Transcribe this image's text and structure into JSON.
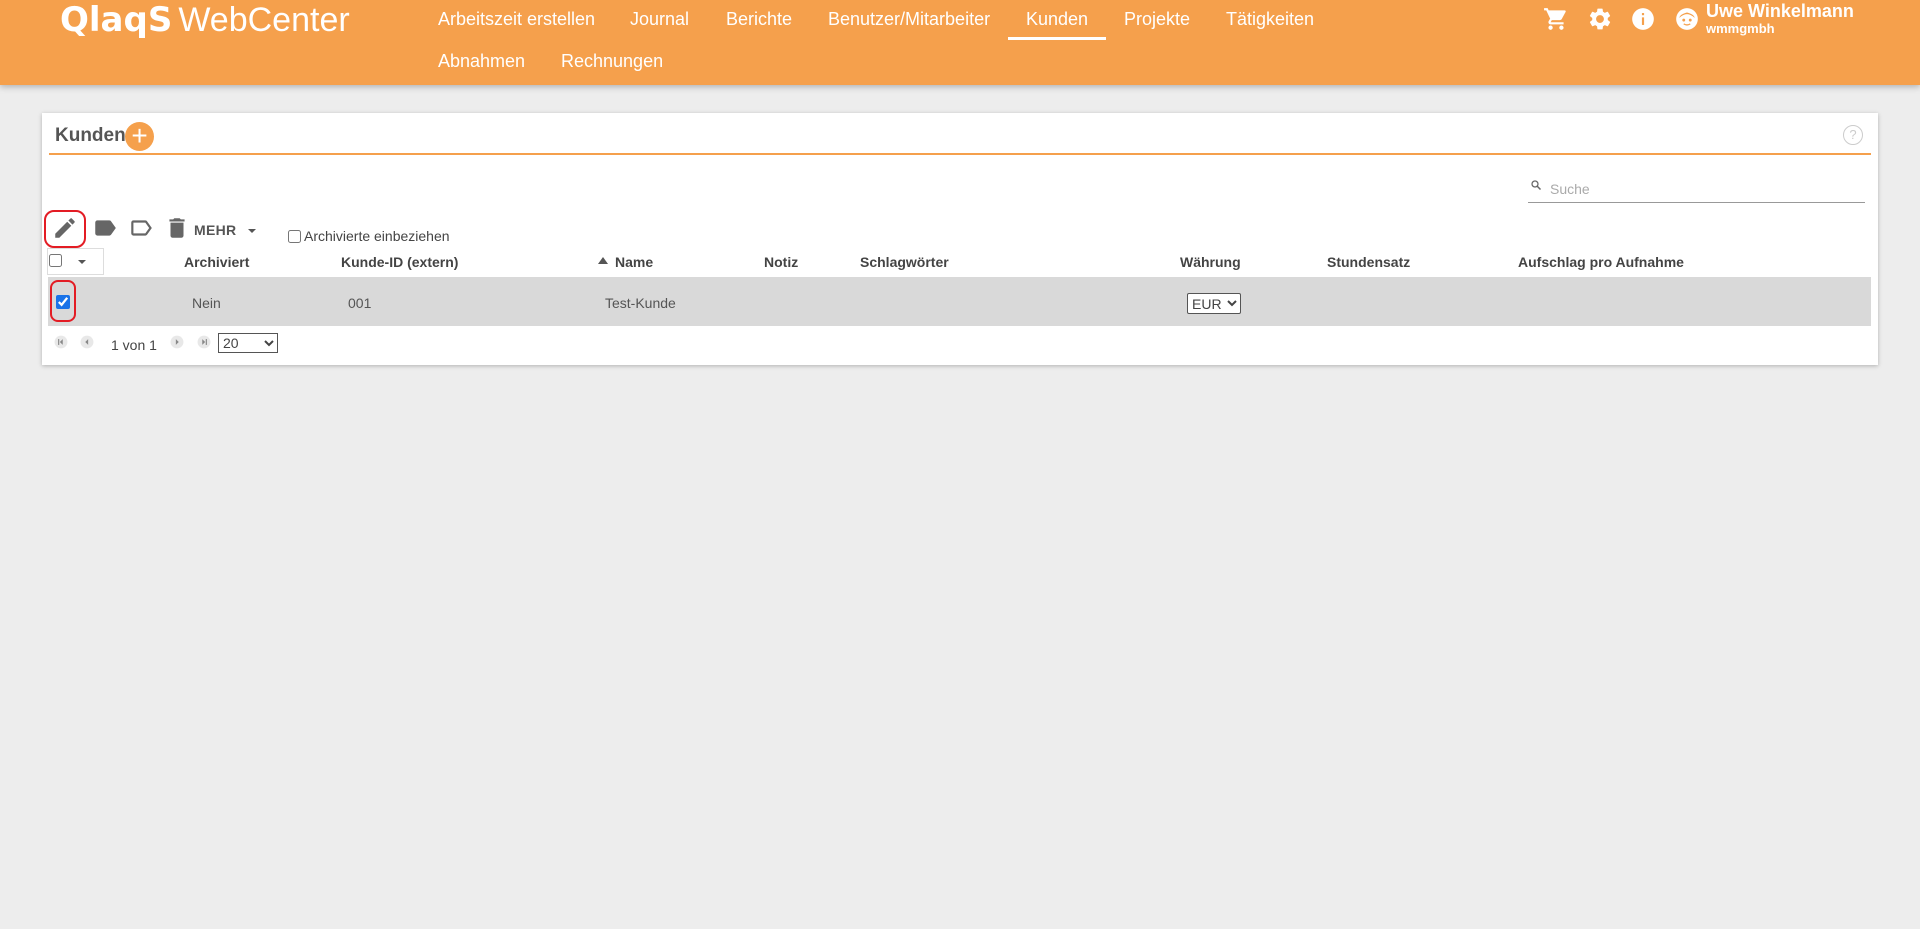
{
  "header": {
    "logo_brand": "QlaqS",
    "logo_suffix": "WebCenter",
    "nav": [
      {
        "label": "Arbeitszeit erstellen"
      },
      {
        "label": "Journal"
      },
      {
        "label": "Berichte"
      },
      {
        "label": "Benutzer/Mitarbeiter"
      },
      {
        "label": "Kunden",
        "active": true
      },
      {
        "label": "Projekte"
      },
      {
        "label": "Tätigkeiten"
      },
      {
        "label": "Abnahmen"
      },
      {
        "label": "Rechnungen"
      }
    ],
    "icons": [
      "cart-icon",
      "gear-icon",
      "info-icon",
      "user-avatar-icon"
    ],
    "user": {
      "name": "Uwe Winkelmann",
      "org": "wmmgmbh"
    },
    "color": "#f5a04c"
  },
  "panel": {
    "title": "Kunden",
    "add_label": "+",
    "help_label": "?",
    "search": {
      "placeholder": "Suche",
      "value": ""
    },
    "toolbar": {
      "more_label": "MEHR",
      "include_archived_label": "Archivierte einbeziehen",
      "include_archived_checked": false
    },
    "columns": [
      "Archiviert",
      "Kunde-ID (extern)",
      "Name",
      "Notiz",
      "Schlagwörter",
      "Währung",
      "Stundensatz",
      "Aufschlag pro Aufnahme"
    ],
    "sorted_column": "Name",
    "rows": [
      {
        "selected": true,
        "archived": "Nein",
        "customer_id": "001",
        "name": "Test-Kunde",
        "note": "",
        "tags": "",
        "currency": "EUR",
        "hourly_rate": "",
        "surcharge": ""
      }
    ],
    "pager": {
      "text": "1 von 1",
      "page_size": "20",
      "page_size_options": [
        "20"
      ]
    }
  },
  "highlight_color": "#e31c24"
}
